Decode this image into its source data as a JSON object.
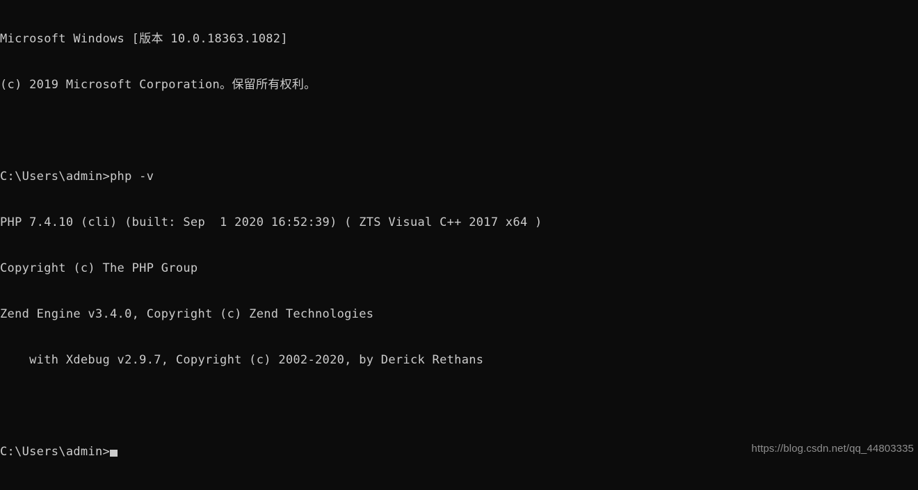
{
  "terminal": {
    "background_color": "#0c0c0c",
    "text_color": "#cccccc",
    "lines": [
      "Microsoft Windows [版本 10.0.18363.1082]",
      "(c) 2019 Microsoft Corporation。保留所有权利。",
      "",
      "C:\\Users\\admin>php -v",
      "PHP 7.4.10 (cli) (built: Sep  1 2020 16:52:39) ( ZTS Visual C++ 2017 x64 )",
      "Copyright (c) The PHP Group",
      "Zend Engine v3.4.0, Copyright (c) Zend Technologies",
      "    with Xdebug v2.9.7, Copyright (c) 2002-2020, by Derick Rethans",
      ""
    ],
    "prompt": "C:\\Users\\admin>",
    "command_input": "",
    "cursor": {
      "visible": true,
      "shape": "block",
      "color": "#cccccc"
    }
  },
  "watermark": {
    "text": "https://blog.csdn.net/qq_44803335",
    "color": "#8f8f8f"
  }
}
